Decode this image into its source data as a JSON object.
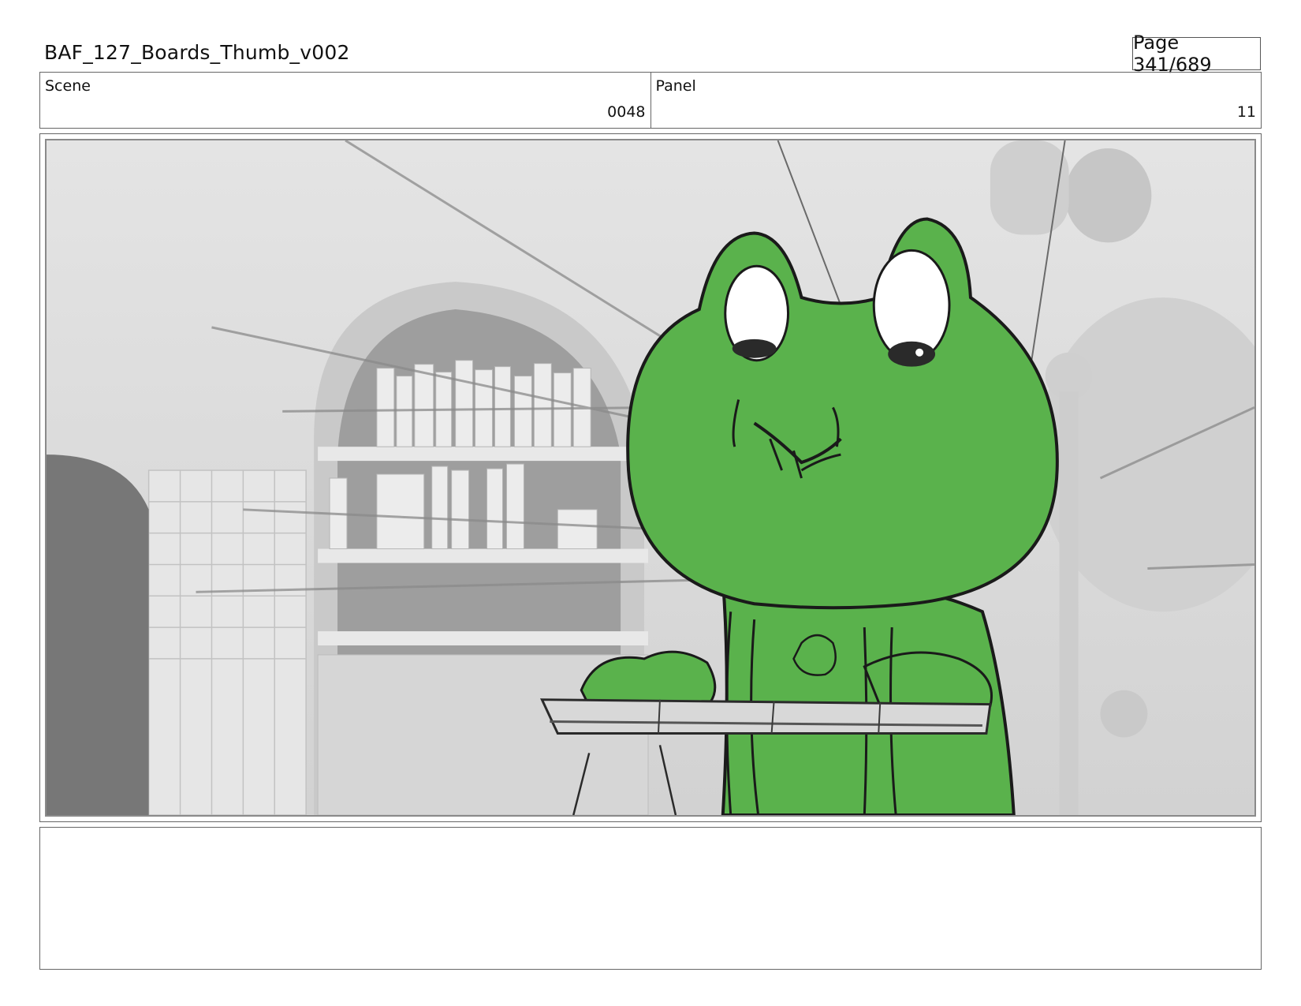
{
  "header": {
    "title": "BAF_127_Boards_Thumb_v002",
    "page": "Page 341/689"
  },
  "info": {
    "scene_label": "Scene",
    "scene_value": "0048",
    "panel_label": "Panel",
    "panel_value": "11"
  },
  "panel": {
    "colors": {
      "character_fill": "#5ab24c",
      "background_gray": "#d9d9d9",
      "outline": "#1a1a1a"
    }
  },
  "notes": {
    "text": ""
  }
}
